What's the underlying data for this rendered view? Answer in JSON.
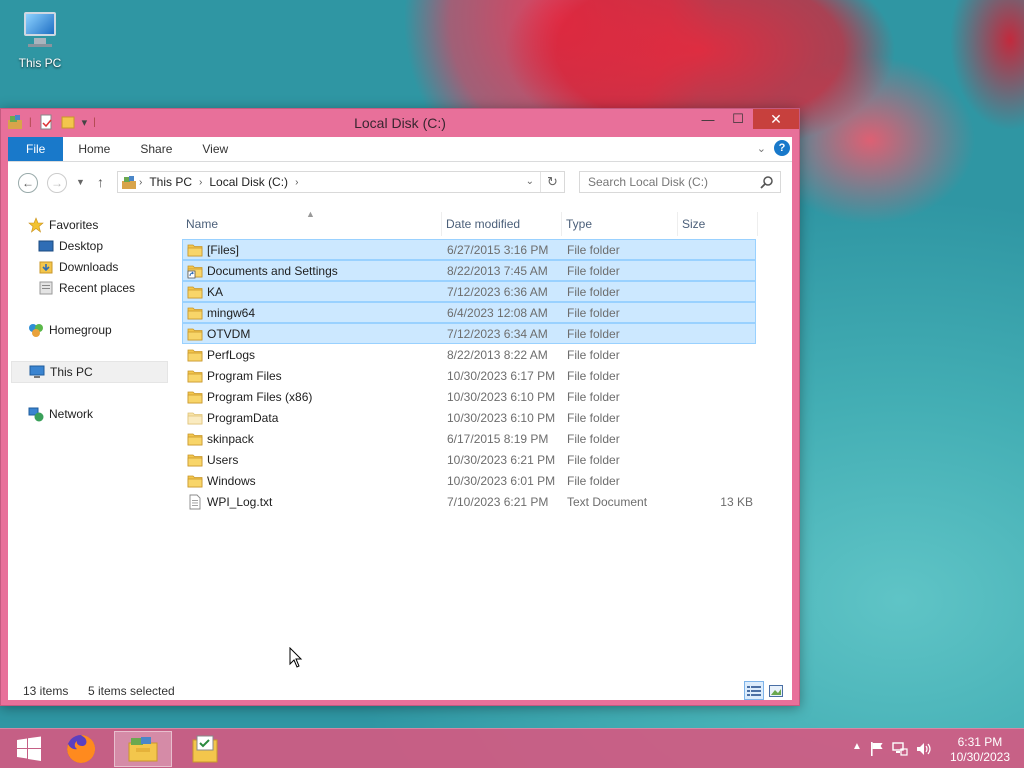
{
  "desktop": {
    "icons": [
      {
        "label": "This PC"
      }
    ]
  },
  "window": {
    "title": "Local Disk (C:)",
    "controls": {
      "minimize": "—",
      "maximize": "☐",
      "close": "✕"
    }
  },
  "ribbon": {
    "tabs": [
      "File",
      "Home",
      "Share",
      "View"
    ]
  },
  "address": {
    "segments": [
      "This PC",
      "Local Disk (C:)"
    ]
  },
  "search": {
    "placeholder": "Search Local Disk (C:)"
  },
  "nav": {
    "favorites": "Favorites",
    "desktop": "Desktop",
    "downloads": "Downloads",
    "recent": "Recent places",
    "homegroup": "Homegroup",
    "thispc": "This PC",
    "network": "Network"
  },
  "columns": {
    "name": "Name",
    "date": "Date modified",
    "type": "Type",
    "size": "Size"
  },
  "files": [
    {
      "name": "[Files]",
      "date": "6/27/2015 3:16 PM",
      "type": "File folder",
      "size": "",
      "selected": true,
      "icon": "folder-icon"
    },
    {
      "name": "Documents and Settings",
      "date": "8/22/2013 7:45 AM",
      "type": "File folder",
      "size": "",
      "selected": true,
      "icon": "shortcut-folder-icon"
    },
    {
      "name": "KA",
      "date": "7/12/2023 6:36 AM",
      "type": "File folder",
      "size": "",
      "selected": true,
      "icon": "folder-icon"
    },
    {
      "name": "mingw64",
      "date": "6/4/2023 12:08 AM",
      "type": "File folder",
      "size": "",
      "selected": true,
      "icon": "folder-icon"
    },
    {
      "name": "OTVDM",
      "date": "7/12/2023 6:34 AM",
      "type": "File folder",
      "size": "",
      "selected": true,
      "icon": "folder-icon"
    },
    {
      "name": "PerfLogs",
      "date": "8/22/2013 8:22 AM",
      "type": "File folder",
      "size": "",
      "selected": false,
      "icon": "folder-icon"
    },
    {
      "name": "Program Files",
      "date": "10/30/2023 6:17 PM",
      "type": "File folder",
      "size": "",
      "selected": false,
      "icon": "folder-icon"
    },
    {
      "name": "Program Files (x86)",
      "date": "10/30/2023 6:10 PM",
      "type": "File folder",
      "size": "",
      "selected": false,
      "icon": "folder-icon"
    },
    {
      "name": "ProgramData",
      "date": "10/30/2023 6:10 PM",
      "type": "File folder",
      "size": "",
      "selected": false,
      "icon": "hidden-folder-icon"
    },
    {
      "name": "skinpack",
      "date": "6/17/2015 8:19 PM",
      "type": "File folder",
      "size": "",
      "selected": false,
      "icon": "folder-icon"
    },
    {
      "name": "Users",
      "date": "10/30/2023 6:21 PM",
      "type": "File folder",
      "size": "",
      "selected": false,
      "icon": "folder-icon"
    },
    {
      "name": "Windows",
      "date": "10/30/2023 6:01 PM",
      "type": "File folder",
      "size": "",
      "selected": false,
      "icon": "folder-icon"
    },
    {
      "name": "WPI_Log.txt",
      "date": "7/10/2023 6:21 PM",
      "type": "Text Document",
      "size": "13 KB",
      "selected": false,
      "icon": "text-file-icon"
    }
  ],
  "status": {
    "items": "13 items",
    "selected": "5 items selected"
  },
  "taskbar": {
    "clock_time": "6:31 PM",
    "clock_date": "10/30/2023"
  },
  "colors": {
    "accent": "#1979ca",
    "selection": "#cce8ff",
    "selection_border": "#99d1ff",
    "window_frame": "#e8709a",
    "close_button": "#c7403d"
  }
}
